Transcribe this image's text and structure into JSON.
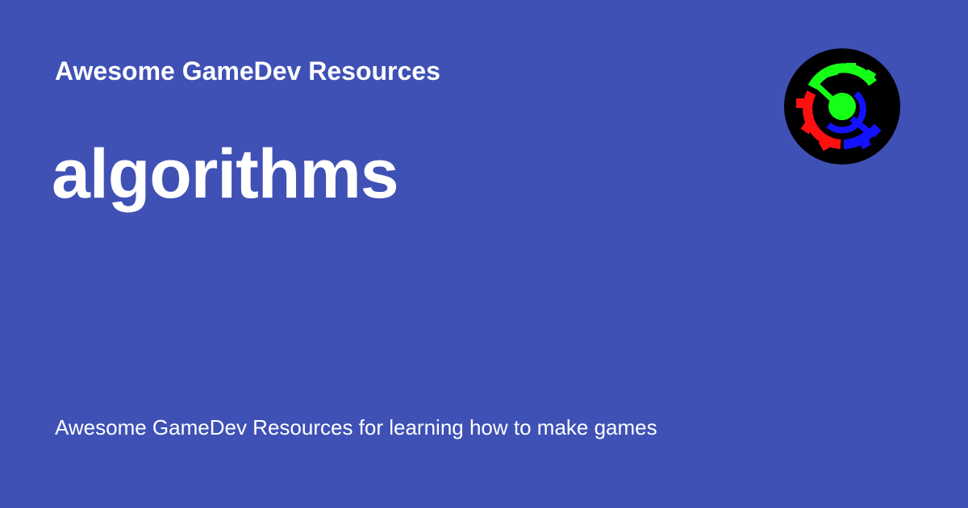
{
  "card": {
    "site_name": "Awesome GameDev Resources",
    "title": "algorithms",
    "description": "Awesome GameDev Resources for learning how to make games"
  },
  "logo": {
    "icon": "gear-logo-icon",
    "colors": {
      "background": "#000000",
      "green": "#16ff16",
      "red": "#ff0f0f",
      "blue": "#1212ff"
    }
  },
  "theme": {
    "background": "#3f51b5",
    "text": "#ffffff"
  }
}
